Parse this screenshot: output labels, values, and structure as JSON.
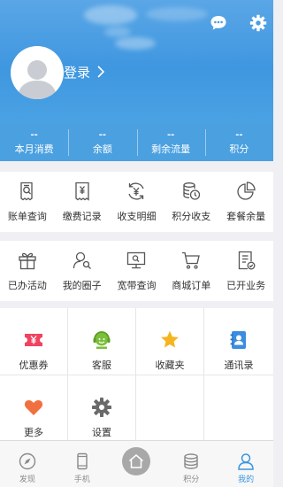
{
  "header": {
    "login_label": "登录",
    "message_icon": "chat-bubble-icon",
    "settings_icon": "gear-icon"
  },
  "stats": [
    {
      "value": "--",
      "label": "本月消费"
    },
    {
      "value": "--",
      "label": "余额"
    },
    {
      "value": "--",
      "label": "剩余流量"
    },
    {
      "value": "--",
      "label": "积分"
    }
  ],
  "row1": [
    {
      "label": "账单查询",
      "icon": "bill-search-icon"
    },
    {
      "label": "缴费记录",
      "icon": "receipt-icon"
    },
    {
      "label": "收支明细",
      "icon": "yuan-exchange-icon"
    },
    {
      "label": "积分收支",
      "icon": "coins-icon"
    },
    {
      "label": "套餐余量",
      "icon": "pie-chart-icon"
    }
  ],
  "row2": [
    {
      "label": "已办活动",
      "icon": "gift-icon"
    },
    {
      "label": "我的圈子",
      "icon": "user-search-icon"
    },
    {
      "label": "宽带查询",
      "icon": "monitor-icon"
    },
    {
      "label": "商城订单",
      "icon": "shopping-cart-icon"
    },
    {
      "label": "已开业务",
      "icon": "document-check-icon"
    }
  ],
  "grid": [
    {
      "label": "优惠券",
      "icon": "coupon-icon",
      "color": "#f0435f"
    },
    {
      "label": "客服",
      "icon": "customer-service-icon",
      "color": "#7bbf3a"
    },
    {
      "label": "收藏夹",
      "icon": "star-icon",
      "color": "#f5b520"
    },
    {
      "label": "通讯录",
      "icon": "contacts-icon",
      "color": "#3a8de0"
    },
    {
      "label": "更多",
      "icon": "heart-icon",
      "color": "#f07040"
    },
    {
      "label": "设置",
      "icon": "settings-gear-icon",
      "color": "#6a6a6a"
    }
  ],
  "nav": [
    {
      "label": "发现",
      "icon": "compass-icon",
      "active": false
    },
    {
      "label": "手机",
      "icon": "phone-icon",
      "active": false
    },
    {
      "label": "",
      "icon": "home-icon",
      "active": false
    },
    {
      "label": "积分",
      "icon": "database-icon",
      "active": false
    },
    {
      "label": "我的",
      "icon": "user-icon",
      "active": true
    }
  ],
  "colors": {
    "header_blue": "#4ba0e0",
    "active_tab": "#3a95e0",
    "icon_gray": "#555555"
  }
}
